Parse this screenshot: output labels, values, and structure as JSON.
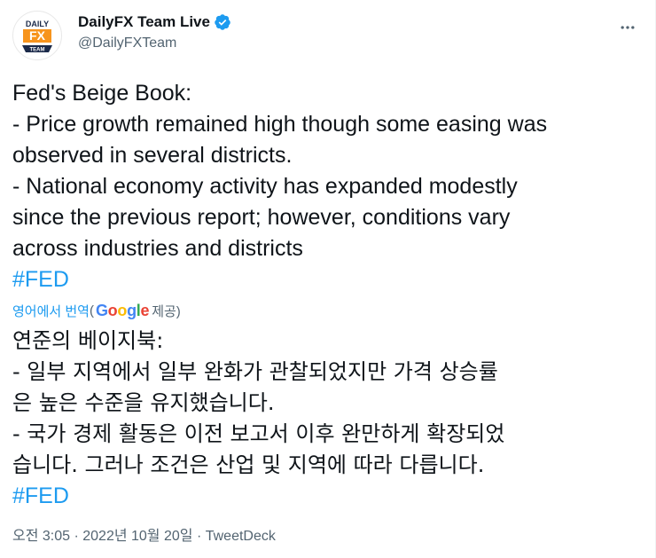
{
  "author": {
    "display_name": "DailyFX Team Live",
    "handle": "@DailyFXTeam",
    "avatar_text_top": "DAILY",
    "avatar_text_mid": "FX",
    "avatar_text_bottom": "TEAM"
  },
  "icons": {
    "verified": "verified-badge-icon",
    "more": "more-options-icon"
  },
  "colors": {
    "link": "#1d9bf0",
    "secondary_text": "#536471",
    "avatar_orange": "#f7941d",
    "avatar_navy": "#1b2a4a"
  },
  "tweet": {
    "lines": [
      "Fed's Beige Book:",
      "- Price growth remained high though some easing was",
      "observed in several districts.",
      "- National economy activity has expanded modestly",
      "since the previous report; however, conditions vary",
      "across industries and districts"
    ],
    "hashtag": "#FED"
  },
  "translation": {
    "link_label": "영어에서 번역",
    "open_paren": "(",
    "google_letters": [
      "G",
      "o",
      "o",
      "g",
      "l",
      "e"
    ],
    "provided_by": " 제공)",
    "lines": [
      "연준의 베이지북:",
      "- 일부 지역에서 일부 완화가 관찰되었지만 가격 상승률",
      "은 높은 수준을 유지했습니다.",
      "- 국가 경제 활동은 이전 보고서 이후 완만하게 확장되었",
      "습니다. 그러나 조건은 산업 및 지역에 따라 다릅니다."
    ],
    "hashtag": "#FED"
  },
  "footer": {
    "time": "오전 3:05",
    "separator_1": " · ",
    "date": "2022년 10월 20일",
    "separator_2": " · ",
    "source": "TweetDeck"
  }
}
